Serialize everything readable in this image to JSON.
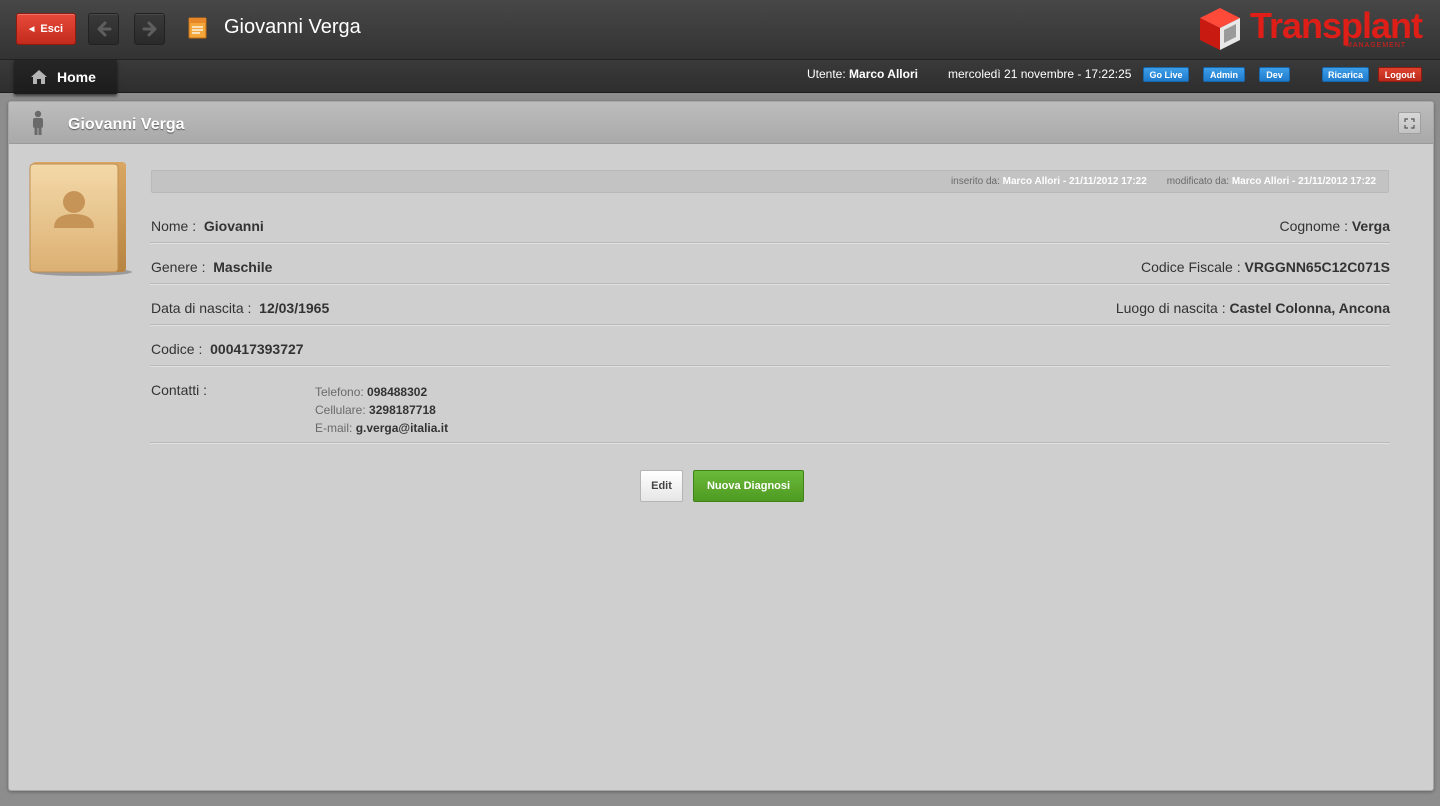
{
  "topbar": {
    "exit_label": "Esci",
    "title": "Giovanni Verga",
    "logo_text": "Transplant",
    "logo_sub": "MANAGEMENT"
  },
  "nav": {
    "home_label": "Home",
    "user_label": "Utente:",
    "user_name": "Marco Allori",
    "datetime": "mercoledì 21 novembre - 17:22:25",
    "buttons": {
      "golive": "Go Live",
      "admin": "Admin",
      "dev": "Dev",
      "ricarica": "Ricarica",
      "logout": "Logout"
    }
  },
  "panel": {
    "title": "Giovanni Verga",
    "meta": {
      "inserted_label": "inserito da:",
      "inserted_value": "Marco Allori - 21/11/2012 17:22",
      "modified_label": "modificato da:",
      "modified_value": "Marco Allori - 21/11/2012 17:22"
    },
    "fields": {
      "nome_label": "Nome :",
      "nome_value": "Giovanni",
      "cognome_label": "Cognome :",
      "cognome_value": "Verga",
      "genere_label": "Genere :",
      "genere_value": "Maschile",
      "cf_label": "Codice Fiscale :",
      "cf_value": "VRGGNN65C12C071S",
      "nascita_label": "Data di nascita :",
      "nascita_value": "12/03/1965",
      "luogo_label": "Luogo di nascita :",
      "luogo_value": "Castel Colonna, Ancona",
      "codice_label": "Codice :",
      "codice_value": "000417393727",
      "contatti_label": "Contatti :",
      "telefono_label": "Telefono:",
      "telefono_value": "098488302",
      "cellulare_label": "Cellulare:",
      "cellulare_value": "3298187718",
      "email_label": "E-mail:",
      "email_value": "g.verga@italia.it"
    },
    "actions": {
      "edit": "Edit",
      "nuova_diagnosi": "Nuova Diagnosi"
    }
  },
  "colors": {
    "accent_red": "#c22a1c",
    "accent_blue": "#1f7bcc",
    "accent_green": "#4e9a22"
  }
}
